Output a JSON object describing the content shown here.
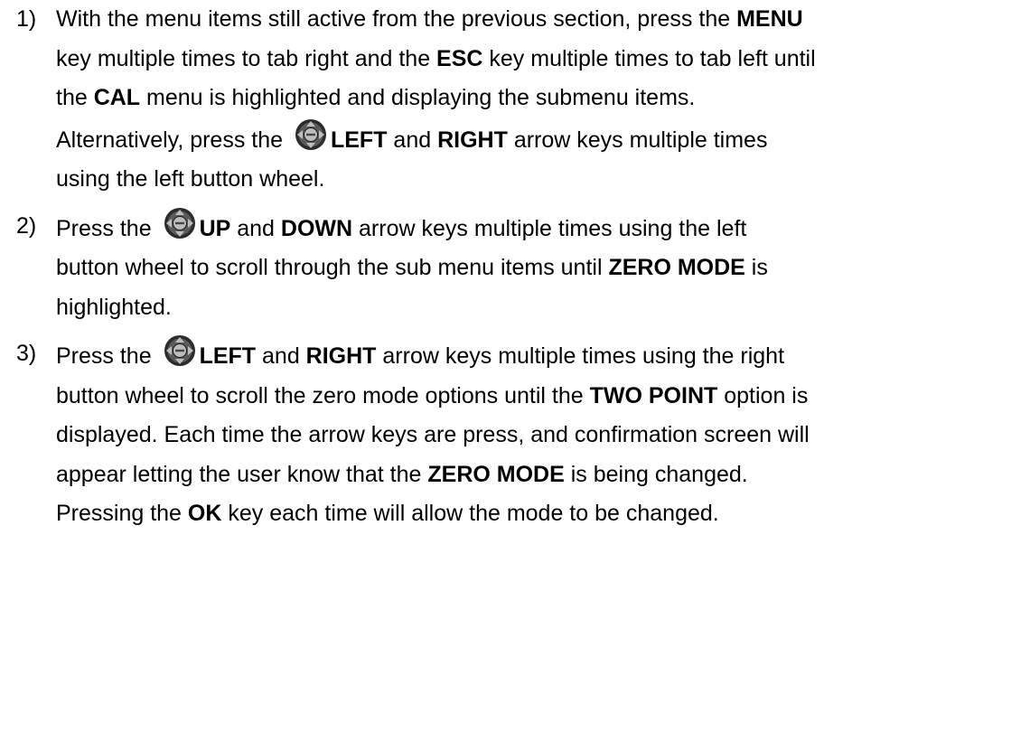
{
  "steps": [
    {
      "number": "1)",
      "lines": [
        [
          {
            "t": "With the menu items still active from the previous section, press the "
          },
          {
            "t": "MENU",
            "b": true
          }
        ],
        [
          {
            "t": "key multiple times to tab right and the "
          },
          {
            "t": "ESC",
            "b": true
          },
          {
            "t": " key multiple times to tab left until"
          }
        ],
        [
          {
            "t": "the "
          },
          {
            "t": "CAL",
            "b": true
          },
          {
            "t": " menu is highlighted and displaying the submenu items."
          }
        ],
        [
          {
            "t": "Alternatively, press the "
          },
          {
            "icon": "button-wheel-icon"
          },
          {
            "t": "LEFT",
            "b": true
          },
          {
            "t": " and "
          },
          {
            "t": "RIGHT",
            "b": true
          },
          {
            "t": " arrow keys multiple times"
          }
        ],
        [
          {
            "t": "using the left button wheel."
          }
        ]
      ]
    },
    {
      "number": "2)",
      "lines": [
        [
          {
            "t": "Press the "
          },
          {
            "icon": "button-wheel-icon"
          },
          {
            "t": "UP",
            "b": true
          },
          {
            "t": " and "
          },
          {
            "t": "DOWN",
            "b": true
          },
          {
            "t": " arrow keys multiple times using the left"
          }
        ],
        [
          {
            "t": "button wheel to scroll through the sub menu items until "
          },
          {
            "t": "ZERO MODE",
            "b": true
          },
          {
            "t": " is"
          }
        ],
        [
          {
            "t": "highlighted."
          }
        ]
      ]
    },
    {
      "number": "3)",
      "lines": [
        [
          {
            "t": "Press the "
          },
          {
            "icon": "button-wheel-icon"
          },
          {
            "t": "LEFT",
            "b": true
          },
          {
            "t": " and "
          },
          {
            "t": "RIGHT",
            "b": true
          },
          {
            "t": " arrow keys multiple times using the right"
          }
        ],
        [
          {
            "t": "button wheel to scroll the zero mode options until the "
          },
          {
            "t": "TWO POINT",
            "b": true
          },
          {
            "t": " option is"
          }
        ],
        [
          {
            "t": "displayed.  Each time the arrow keys are press, and confirmation screen will"
          }
        ],
        [
          {
            "t": "appear letting the user know that the "
          },
          {
            "t": "ZERO MODE",
            "b": true
          },
          {
            "t": " is being changed."
          }
        ],
        [
          {
            "t": "Pressing the "
          },
          {
            "t": "OK",
            "b": true
          },
          {
            "t": " key each time will allow the mode to be changed."
          }
        ]
      ]
    }
  ],
  "icon_colors": {
    "ring": "#2b2b2b",
    "face": "#bdbdbd",
    "arrow": "#000000"
  }
}
